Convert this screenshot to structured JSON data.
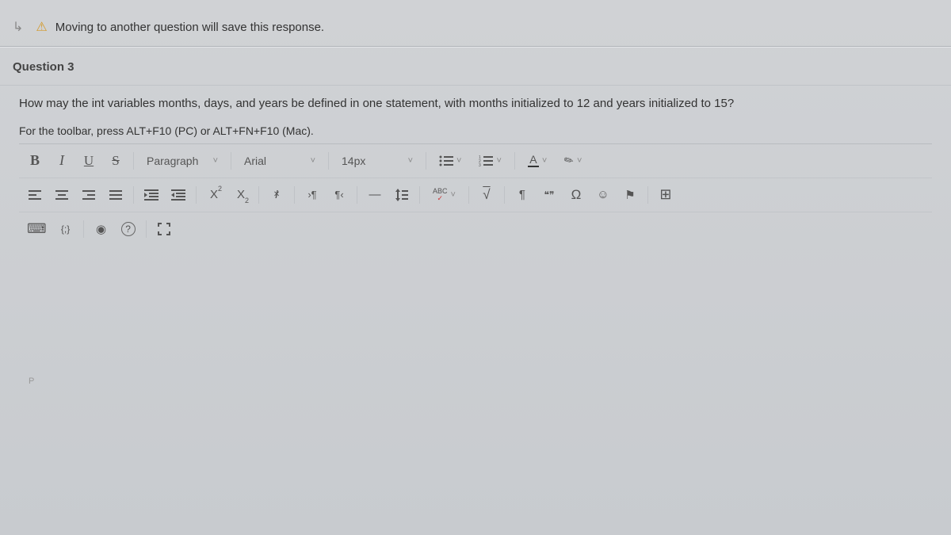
{
  "warning": {
    "text": "Moving to another question will save this response."
  },
  "question": {
    "label": "Question 3",
    "text": "How may the int variables months, days, and years be defined in one statement, with months initialized to 12 and years initialized to 15?",
    "hint": "For the toolbar, press ALT+F10 (PC) or ALT+FN+F10 (Mac)."
  },
  "toolbar": {
    "bold": "B",
    "italic": "I",
    "underline": "U",
    "strike": "S",
    "format_dd": "Paragraph",
    "font_dd": "Arial",
    "size_dd": "14px",
    "text_color": "A",
    "superscript": "X",
    "subscript": "X",
    "ltr": "¶",
    "rtl": "¶",
    "abc": "ABC",
    "math": "√",
    "pilcrow": "¶",
    "quote": "❝❞",
    "omega": "Ω",
    "emoji": "☺",
    "anchor": "⚑",
    "table": "⊞",
    "keyboard": "⌨",
    "code": "{;}",
    "preview": "◉",
    "help": "?",
    "fullscreen": "⛶"
  },
  "editor": {
    "placeholder_tag": "P"
  }
}
